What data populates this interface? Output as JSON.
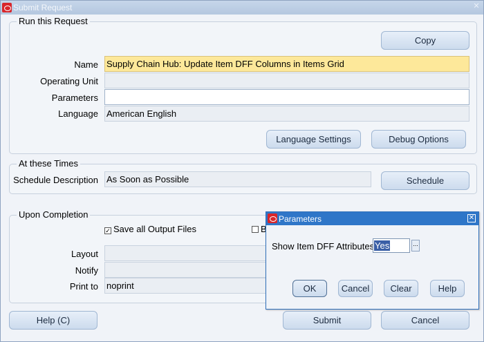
{
  "window": {
    "title": "Submit Request"
  },
  "run_request": {
    "group_title": "Run this Request",
    "copy_button": "Copy",
    "name_label": "Name",
    "name_value": "Supply Chain Hub: Update Item DFF Columns in Items Grid",
    "operating_unit_label": "Operating Unit",
    "operating_unit_value": "",
    "parameters_label": "Parameters",
    "parameters_value": "",
    "language_label": "Language",
    "language_value": "American English",
    "language_settings_button": "Language Settings",
    "debug_options_button": "Debug Options"
  },
  "times": {
    "group_title": "At these Times",
    "schedule_label": "Schedule Description",
    "schedule_value": "As Soon as Possible",
    "schedule_button": "Schedule"
  },
  "completion": {
    "group_title": "Upon Completion",
    "save_output_label": "Save all Output Files",
    "save_output_checked": true,
    "partial_check_label": "B",
    "layout_label": "Layout",
    "layout_value": "",
    "notify_label": "Notify",
    "notify_value": "",
    "print_to_label": "Print to",
    "print_to_value": "noprint"
  },
  "footer": {
    "help_button": "Help (C)",
    "submit_button": "Submit",
    "cancel_button": "Cancel"
  },
  "parameters_dialog": {
    "title": "Parameters",
    "field_label": "Show Item DFF Attributes",
    "field_value": "Yes",
    "lov_button": "...",
    "ok_button": "OK",
    "cancel_button": "Cancel",
    "clear_button": "Clear",
    "help_button": "Help"
  },
  "colors": {
    "required_field": "#fde89a",
    "dialog_title": "#2f76c8",
    "oracle_red": "#d8262b"
  }
}
